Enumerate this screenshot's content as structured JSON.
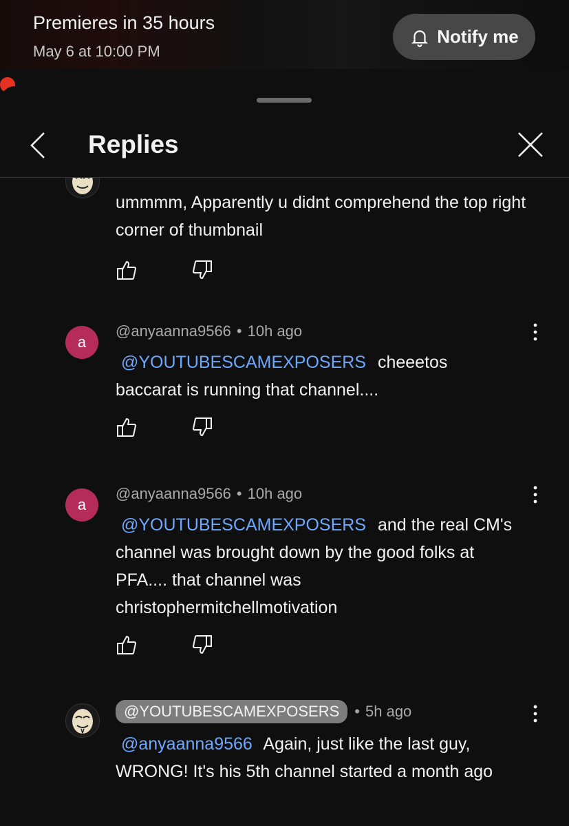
{
  "banner": {
    "title": "Premieres in 35 hours",
    "subtitle": "May 6 at 10:00 PM",
    "notify_label": "Notify me"
  },
  "header": {
    "title": "Replies"
  },
  "comments": [
    {
      "author": "",
      "time": "",
      "mention": "",
      "text": "ummmm, Apparently u didnt comprehend the top right corner of thumbnail",
      "avatar_letter": ""
    },
    {
      "author": "@anyaanna9566",
      "time": "10h ago",
      "mention": "@YOUTUBESCAMEXPOSERS",
      "text": "cheeetos baccarat is running that channel....",
      "avatar_letter": "a"
    },
    {
      "author": "@anyaanna9566",
      "time": "10h ago",
      "mention": "@YOUTUBESCAMEXPOSERS",
      "text": "and the real CM's channel was brought down by the good folks at PFA.... that channel was christophermitchellmotivation",
      "avatar_letter": "a"
    },
    {
      "author": "@YOUTUBESCAMEXPOSERS",
      "time": "5h ago",
      "mention": "@anyaanna9566",
      "text": "Again, just like the last guy, WRONG! It's his 5th channel started a month ago",
      "avatar_letter": ""
    }
  ],
  "colors": {
    "accent_link": "#6ea8fe",
    "avatar_bg": "#b52b5a",
    "record_dot": "#e53222"
  }
}
